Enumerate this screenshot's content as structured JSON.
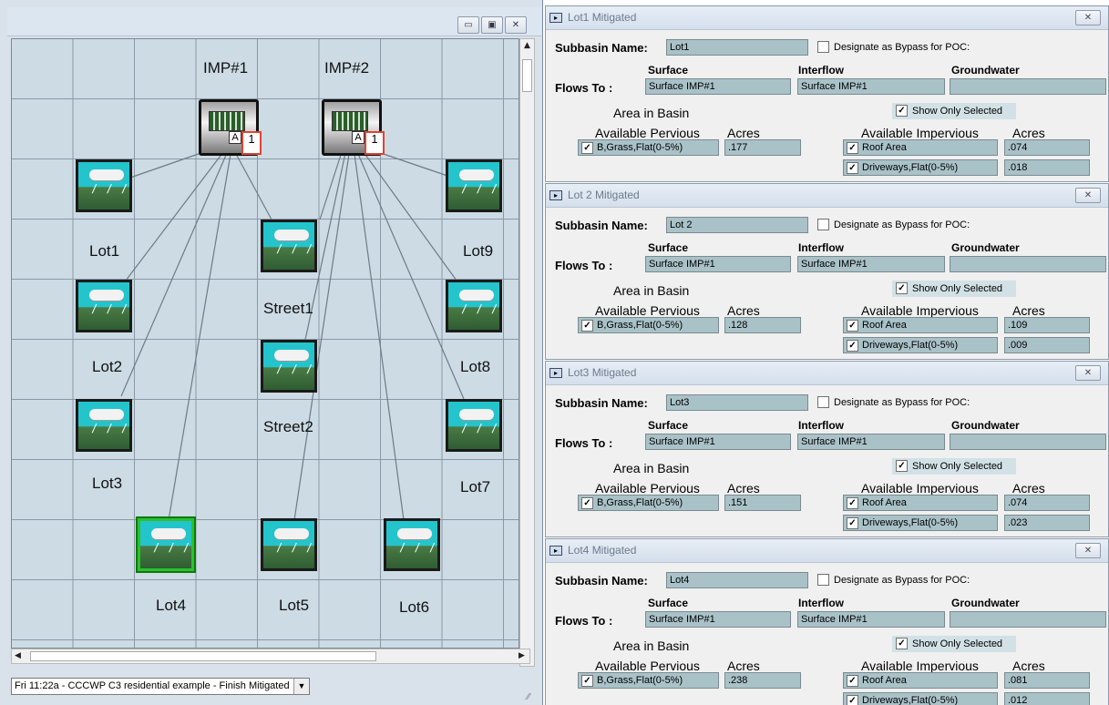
{
  "schematic": {
    "window_buttons": [
      "▭",
      "▣",
      "✕"
    ],
    "node_labels": {
      "imp1": "IMP#1",
      "imp2": "IMP#2",
      "lot1": "Lot1",
      "lot2": "Lot2",
      "lot3": "Lot3",
      "lot4": "Lot4",
      "lot5": "Lot5",
      "lot6": "Lot6",
      "lot7": "Lot7",
      "lot8": "Lot8",
      "lot9": "Lot9",
      "street1": "Street1",
      "street2": "Street2"
    },
    "imp_tag_a": "A",
    "imp_tag_1": "1",
    "status_select_value": "Fri 11:22a - CCCWP C3 residential example - Finish Mitigated"
  },
  "labels": {
    "subbasin_name": "Subbasin Name:",
    "designate_bypass": "Designate as Bypass for POC:",
    "surface": "Surface",
    "interflow": "Interflow",
    "groundwater": "Groundwater",
    "flows_to": "Flows To :",
    "area_in_basin": "Area in Basin",
    "show_only_selected": "Show Only Selected",
    "available_pervious": "Available Pervious",
    "acres": "Acres",
    "available_impervious": "Available Impervious",
    "pervious_item": "B,Grass,Flat(0-5%)",
    "roof_area": "Roof Area",
    "driveways": "Driveways,Flat(0-5%)"
  },
  "panels": [
    {
      "title": "Lot1 Mitigated",
      "name": "Lot1",
      "surface": "Surface IMP#1",
      "interflow": "Surface IMP#1",
      "groundwater": "",
      "pervious_acres": ".177",
      "roof_acres": ".074",
      "driveway_acres": ".018"
    },
    {
      "title": "Lot 2 Mitigated",
      "name": "Lot 2",
      "surface": "Surface IMP#1",
      "interflow": "Surface IMP#1",
      "groundwater": "",
      "pervious_acres": ".128",
      "roof_acres": ".109",
      "driveway_acres": ".009"
    },
    {
      "title": "Lot3 Mitigated",
      "name": "Lot3",
      "surface": "Surface IMP#1",
      "interflow": "Surface IMP#1",
      "groundwater": "",
      "pervious_acres": ".151",
      "roof_acres": ".074",
      "driveway_acres": ".023"
    },
    {
      "title": "Lot4 Mitigated",
      "name": "Lot4",
      "surface": "Surface IMP#1",
      "interflow": "Surface IMP#1",
      "groundwater": "",
      "pervious_acres": ".238",
      "roof_acres": ".081",
      "driveway_acres": ".012"
    }
  ],
  "colors": {
    "field_bg": "#a9c2c8",
    "grid_bg": "#ccdbe4",
    "selected_border": "#2ec02e"
  }
}
